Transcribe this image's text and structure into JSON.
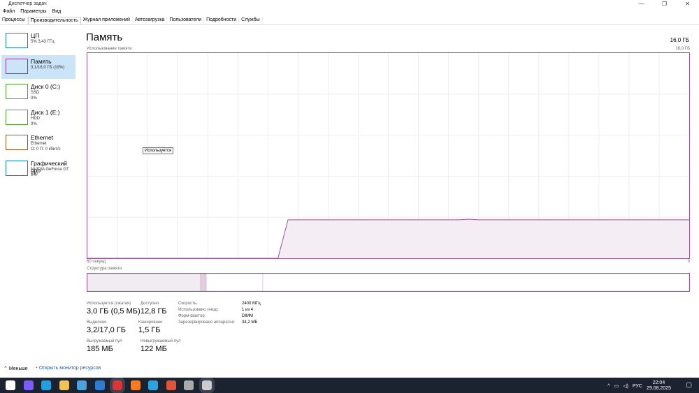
{
  "window": {
    "title": "Диспетчер задач",
    "controls": [
      "—",
      "❐",
      "✕"
    ]
  },
  "menu": [
    "Файл",
    "Параметры",
    "Вид"
  ],
  "tabs": [
    {
      "label": "Процессы"
    },
    {
      "label": "Производительность",
      "active": true
    },
    {
      "label": "Журнал приложений"
    },
    {
      "label": "Автозагрузка"
    },
    {
      "label": "Пользователи"
    },
    {
      "label": "Подробности"
    },
    {
      "label": "Службы"
    }
  ],
  "sidebar": [
    {
      "name": "ЦП",
      "line1": "5% 3,43 ГГц",
      "line2": "",
      "color": "#1a7fc1"
    },
    {
      "name": "Память",
      "line1": "3,1/16,0 ГБ (19%)",
      "line2": "",
      "color": "#8b3a8b",
      "selected": true
    },
    {
      "name": "Диск 0 (C:)",
      "line1": "SSD",
      "line2": "0%",
      "color": "#4da32b"
    },
    {
      "name": "Диск 1 (E:)",
      "line1": "HDD",
      "line2": "0%",
      "color": "#4da32b"
    },
    {
      "name": "Ethernet",
      "line1": "Ethernet",
      "line2": "О: 0 П: 0 кбит/с",
      "color": "#a6561c"
    },
    {
      "name": "Графический про",
      "line1": "NVIDIA GeForce GT 730",
      "line2": "0%",
      "color": "#1a7fc1"
    }
  ],
  "main": {
    "title": "Память",
    "total": "16,0 ГБ",
    "usage_label": "Использование памяти",
    "max_label": "16,0 ГБ",
    "time_left": "60 секунд",
    "time_right": "0",
    "tooltip": "Используется",
    "structure_label": "Структура памяти",
    "color": "#9b4f96"
  },
  "chart_data": {
    "type": "area",
    "xlabel": "60 секунд",
    "ylim": [
      0,
      16
    ],
    "xlim": [
      60,
      0
    ],
    "x_unit": "seconds ago",
    "values_gb": [
      0,
      0,
      0,
      0,
      0,
      0,
      0,
      0,
      0,
      0,
      0,
      0,
      0,
      0,
      0,
      0,
      0,
      0,
      0,
      0,
      3.0,
      3.0,
      3.0,
      3.0,
      3.0,
      3.0,
      3.0,
      3.0,
      3.0,
      3.0,
      3.0,
      3.0,
      3.0,
      3.0,
      3.0,
      3.0,
      3.0,
      3.0,
      3.05,
      3.0,
      3.0,
      3.0,
      3.0,
      3.0,
      3.0,
      3.0,
      3.0,
      3.0,
      3.0,
      3.0,
      3.0,
      3.0,
      3.0,
      3.0,
      3.0,
      3.0,
      3.0,
      3.0,
      3.0,
      3.0,
      3.0
    ],
    "composition": {
      "in_use_gb": 3.0,
      "modified_gb": 0.15,
      "standby_gb": 1.5,
      "free_gb": 11.3
    }
  },
  "stats": [
    {
      "label": "Используется (сжатая)",
      "value": "3,0 ГБ (0,5 МБ)"
    },
    {
      "label": "Доступно",
      "value": "12,8 ГБ"
    },
    {
      "label": "Выделено",
      "value": "3,2/17,0 ГБ"
    },
    {
      "label": "Кэшировано",
      "value": "1,5 ГБ"
    },
    {
      "label": "Выгружаемый пул",
      "value": "185 МБ"
    },
    {
      "label": "Невыгружаемый пул",
      "value": "122 МБ"
    }
  ],
  "specs": [
    {
      "label": "Скорость:",
      "value": "2400 МГц"
    },
    {
      "label": "Использовано гнезд:",
      "value": "1 из 4"
    },
    {
      "label": "Форм-фактор:",
      "value": "DIMM"
    },
    {
      "label": "Зарезервировано аппаратно:",
      "value": "34,2 МБ"
    }
  ],
  "footer": {
    "less": "Меньше",
    "monitor": "Открыть монитор ресурсов"
  },
  "taskbar": {
    "lang": "РУС",
    "time": "22:04",
    "date": "29.08.2025",
    "icons": [
      "windows-start",
      "copilot",
      "edge",
      "file-explorer",
      "store",
      "mail",
      "opera",
      "firefox",
      "telegram",
      "game-launcher",
      "world-of-tanks",
      "task-manager"
    ]
  }
}
